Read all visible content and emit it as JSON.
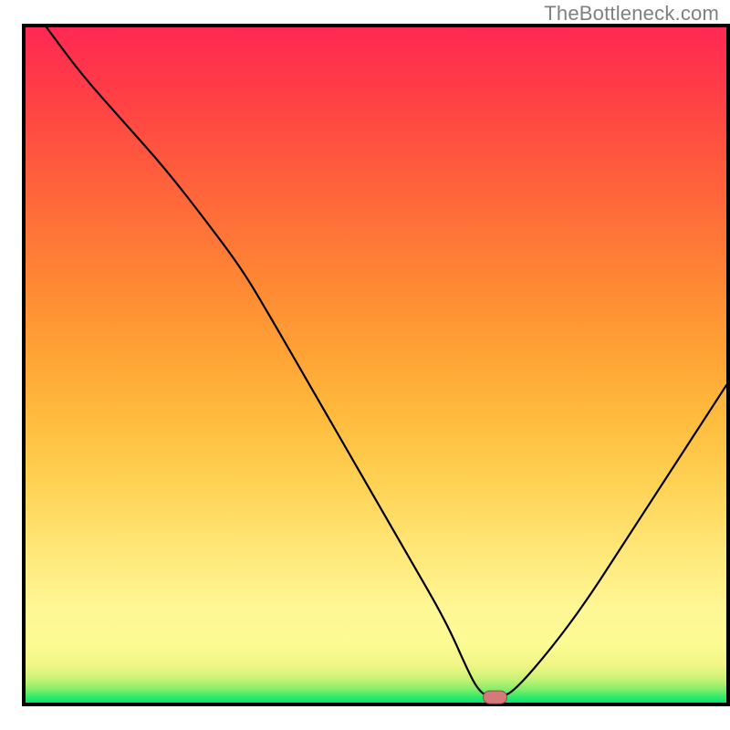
{
  "watermark": "TheBottleneck.com",
  "chart_data": {
    "type": "line",
    "title": "",
    "xlabel": "",
    "ylabel": "",
    "xlim": [
      0,
      100
    ],
    "ylim": [
      0,
      100
    ],
    "x": [
      3,
      8,
      14,
      20,
      26,
      31,
      35,
      40,
      45,
      50,
      55,
      60,
      63,
      64.5,
      66,
      68,
      70,
      75,
      80,
      85,
      90,
      95,
      100
    ],
    "values": [
      100,
      93,
      86,
      79,
      71,
      64,
      57,
      48,
      39,
      30,
      21,
      12,
      5,
      2,
      0.8,
      0.8,
      2,
      8,
      15,
      23,
      31,
      39,
      47
    ],
    "optimal_x": 67,
    "optimal_y": 0.8,
    "gradient_stops": [
      {
        "offset": 0.0,
        "color": "#00e66f"
      },
      {
        "offset": 0.01,
        "color": "#3de969"
      },
      {
        "offset": 0.02,
        "color": "#85ee69"
      },
      {
        "offset": 0.035,
        "color": "#c9f276"
      },
      {
        "offset": 0.055,
        "color": "#f0f686"
      },
      {
        "offset": 0.09,
        "color": "#fdfb93"
      },
      {
        "offset": 0.14,
        "color": "#fff695"
      },
      {
        "offset": 0.22,
        "color": "#ffe87a"
      },
      {
        "offset": 0.32,
        "color": "#ffd355"
      },
      {
        "offset": 0.42,
        "color": "#ffbc3e"
      },
      {
        "offset": 0.52,
        "color": "#ffa235"
      },
      {
        "offset": 0.62,
        "color": "#ff8834"
      },
      {
        "offset": 0.72,
        "color": "#ff6e39"
      },
      {
        "offset": 0.82,
        "color": "#ff543f"
      },
      {
        "offset": 0.92,
        "color": "#ff3a48"
      },
      {
        "offset": 1.0,
        "color": "#ff2852"
      }
    ],
    "curve_color": "#000000",
    "marker_fill": "#d47a7a",
    "marker_stroke": "#9e4a4a",
    "frame_color": "#000000",
    "frame_width": 4
  }
}
